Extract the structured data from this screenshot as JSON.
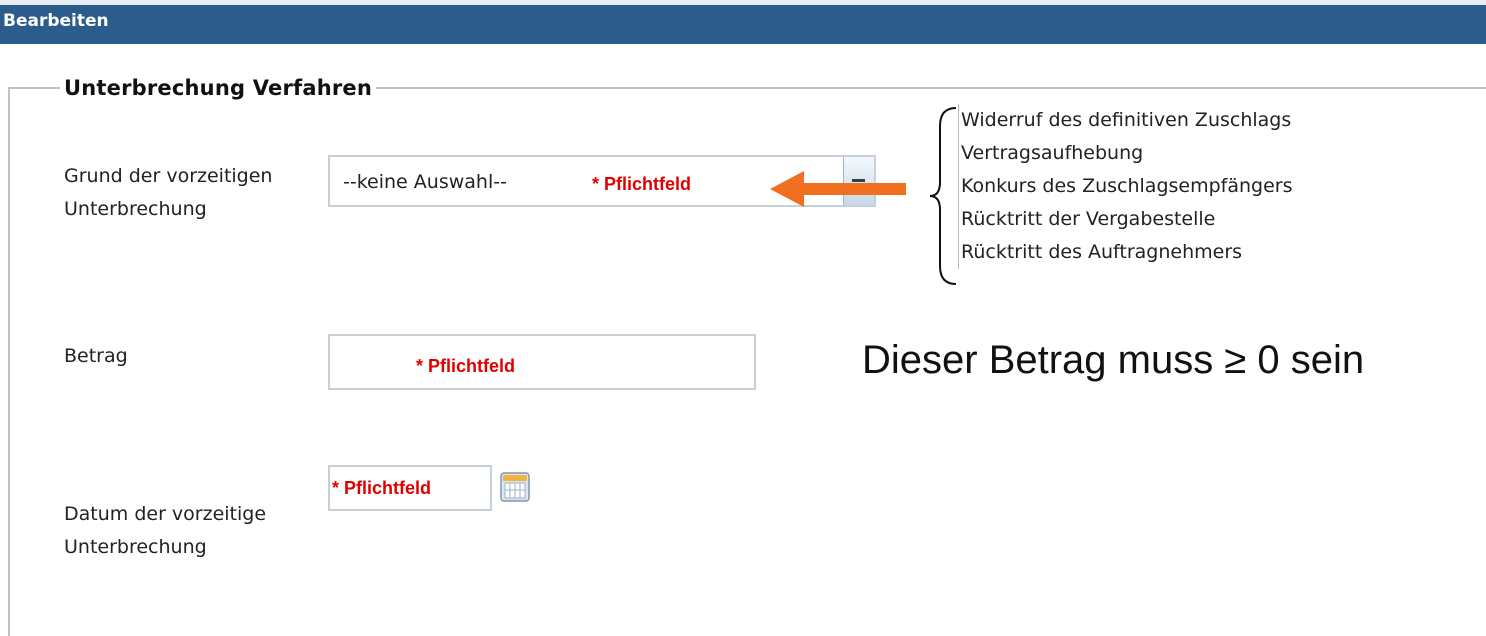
{
  "header": {
    "title": "Bearbeiten"
  },
  "group": {
    "legend": "Unterbrechung Verfahren"
  },
  "fields": {
    "grund": {
      "label": "Grund der vorzeitigen Unterbrechung",
      "selected": "--keine Auswahl--",
      "required_hint": "* Pflichtfeld",
      "options": [
        "Widerruf des definitiven Zuschlags",
        "Vertragsaufhebung",
        "Konkurs des Zuschlagsempfängers",
        "Rücktritt der Vergabestelle",
        "Rücktritt des Auftragnehmers"
      ]
    },
    "betrag": {
      "label": "Betrag",
      "required_hint": "* Pflichtfeld",
      "annotation": "Dieser Betrag muss ≥ 0 sein"
    },
    "datum": {
      "label": "Datum der vorzeitige Unterbrechung",
      "required_hint": "* Pflichtfeld"
    }
  },
  "colors": {
    "header_bg": "#2b5c8c",
    "required_text": "#e10000",
    "arrow": "#f07020"
  },
  "icons": {
    "dropdown": "dropdown-arrow-icon",
    "calendar": "calendar-icon",
    "arrow": "arrow-left-icon",
    "brace": "curly-brace-icon"
  }
}
